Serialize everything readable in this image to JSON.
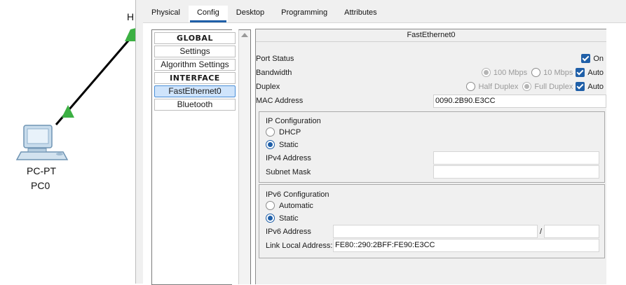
{
  "workspace": {
    "hostname_letter": "H",
    "device_type": "PC-PT",
    "device_name": "PC0",
    "link_color": "#000000",
    "link_status_color": "#3cb043"
  },
  "tabs": [
    {
      "label": "Physical",
      "active": false
    },
    {
      "label": "Config",
      "active": true
    },
    {
      "label": "Desktop",
      "active": false
    },
    {
      "label": "Programming",
      "active": false
    },
    {
      "label": "Attributes",
      "active": false
    }
  ],
  "nav": {
    "items": [
      {
        "label": "GLOBAL",
        "header": true
      },
      {
        "label": "Settings"
      },
      {
        "label": "Algorithm Settings"
      },
      {
        "label": "INTERFACE",
        "header": true
      },
      {
        "label": "FastEthernet0",
        "selected": true
      },
      {
        "label": "Bluetooth"
      }
    ]
  },
  "interface": {
    "title": "FastEthernet0",
    "port_status": {
      "label": "Port Status",
      "on_label": "On",
      "on": true
    },
    "bandwidth": {
      "label": "Bandwidth",
      "opt1": "100 Mbps",
      "opt2": "10 Mbps",
      "auto_label": "Auto",
      "auto": true
    },
    "duplex": {
      "label": "Duplex",
      "opt1": "Half Duplex",
      "opt2": "Full Duplex",
      "auto_label": "Auto",
      "auto": true
    },
    "mac": {
      "label": "MAC Address",
      "value": "0090.2B90.E3CC"
    },
    "ipv4": {
      "title": "IP Configuration",
      "dhcp_label": "DHCP",
      "static_label": "Static",
      "selected": "Static",
      "address_label": "IPv4 Address",
      "address_value": "",
      "mask_label": "Subnet Mask",
      "mask_value": ""
    },
    "ipv6": {
      "title": "IPv6 Configuration",
      "auto_label": "Automatic",
      "static_label": "Static",
      "selected": "Static",
      "address_label": "IPv6 Address",
      "address_value": "",
      "prefix_sep": "/",
      "prefix_value": "",
      "lla_label": "Link Local Address:",
      "lla_value": "FE80::290:2BFF:FE90:E3CC"
    }
  },
  "colors": {
    "accent": "#1f5fa8",
    "selected_bg": "#cfe4fb"
  }
}
